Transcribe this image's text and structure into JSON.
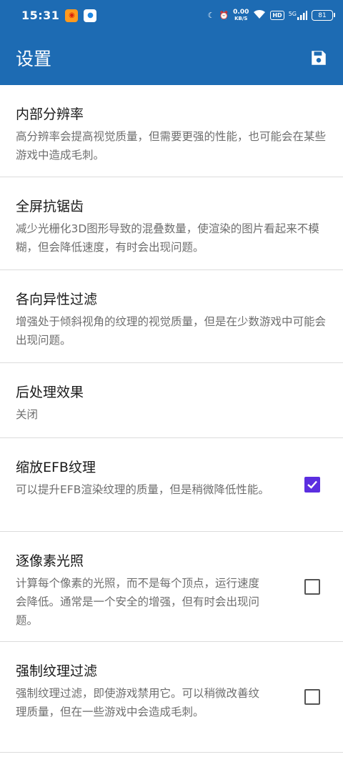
{
  "status_bar": {
    "time": "15:31",
    "net_speed_value": "0.00",
    "net_speed_unit": "KB/S",
    "hd": "HD",
    "signal": "5G",
    "battery": "81"
  },
  "app_bar": {
    "title": "设置"
  },
  "settings": [
    {
      "title": "内部分辨率",
      "summary": "高分辨率会提高视觉质量，但需要更强的性能，也可能会在某些游戏中造成毛刺。",
      "checkbox": null
    },
    {
      "title": "全屏抗锯齿",
      "summary": "减少光栅化3D图形导致的混叠数量，使渲染的图片看起来不模糊，但会降低速度，有时会出现问题。",
      "checkbox": null
    },
    {
      "title": "各向异性过滤",
      "summary": "增强处于倾斜视角的纹理的视觉质量，但是在少数游戏中可能会出现问题。",
      "checkbox": null
    },
    {
      "title": "后处理效果",
      "summary": "关闭",
      "checkbox": null
    },
    {
      "title": "缩放EFB纹理",
      "summary": "可以提升EFB渲染纹理的质量，但是稍微降低性能。",
      "checkbox": true
    },
    {
      "title": "逐像素光照",
      "summary": "计算每个像素的光照，而不是每个顶点，运行速度会降低。通常是一个安全的增强，但有时会出现问题。",
      "checkbox": false
    },
    {
      "title": "强制纹理过滤",
      "summary": "强制纹理过滤，即使游戏禁用它。可以稍微改善纹理质量，但在一些游戏中会造成毛刺。",
      "checkbox": false
    }
  ],
  "colors": {
    "primary": "#1d6bb3",
    "checkbox_checked": "#5b2ee0"
  }
}
